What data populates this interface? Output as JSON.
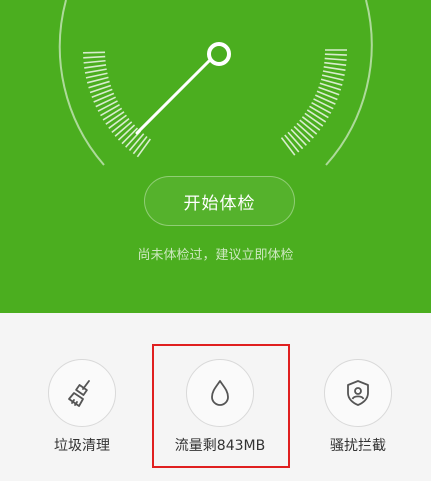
{
  "hero": {
    "start_button_label": "开始体检",
    "hint_text": "尚未体检过，建议立即体检",
    "background_color": "#4bae1f"
  },
  "tools": [
    {
      "label": "垃圾清理",
      "icon": "broom-icon"
    },
    {
      "label": "流量剩843MB",
      "icon": "water-drop-icon"
    },
    {
      "label": "骚扰拦截",
      "icon": "shield-user-icon"
    }
  ],
  "highlight": {
    "color": "#e02020",
    "target": "流量剩843MB"
  }
}
